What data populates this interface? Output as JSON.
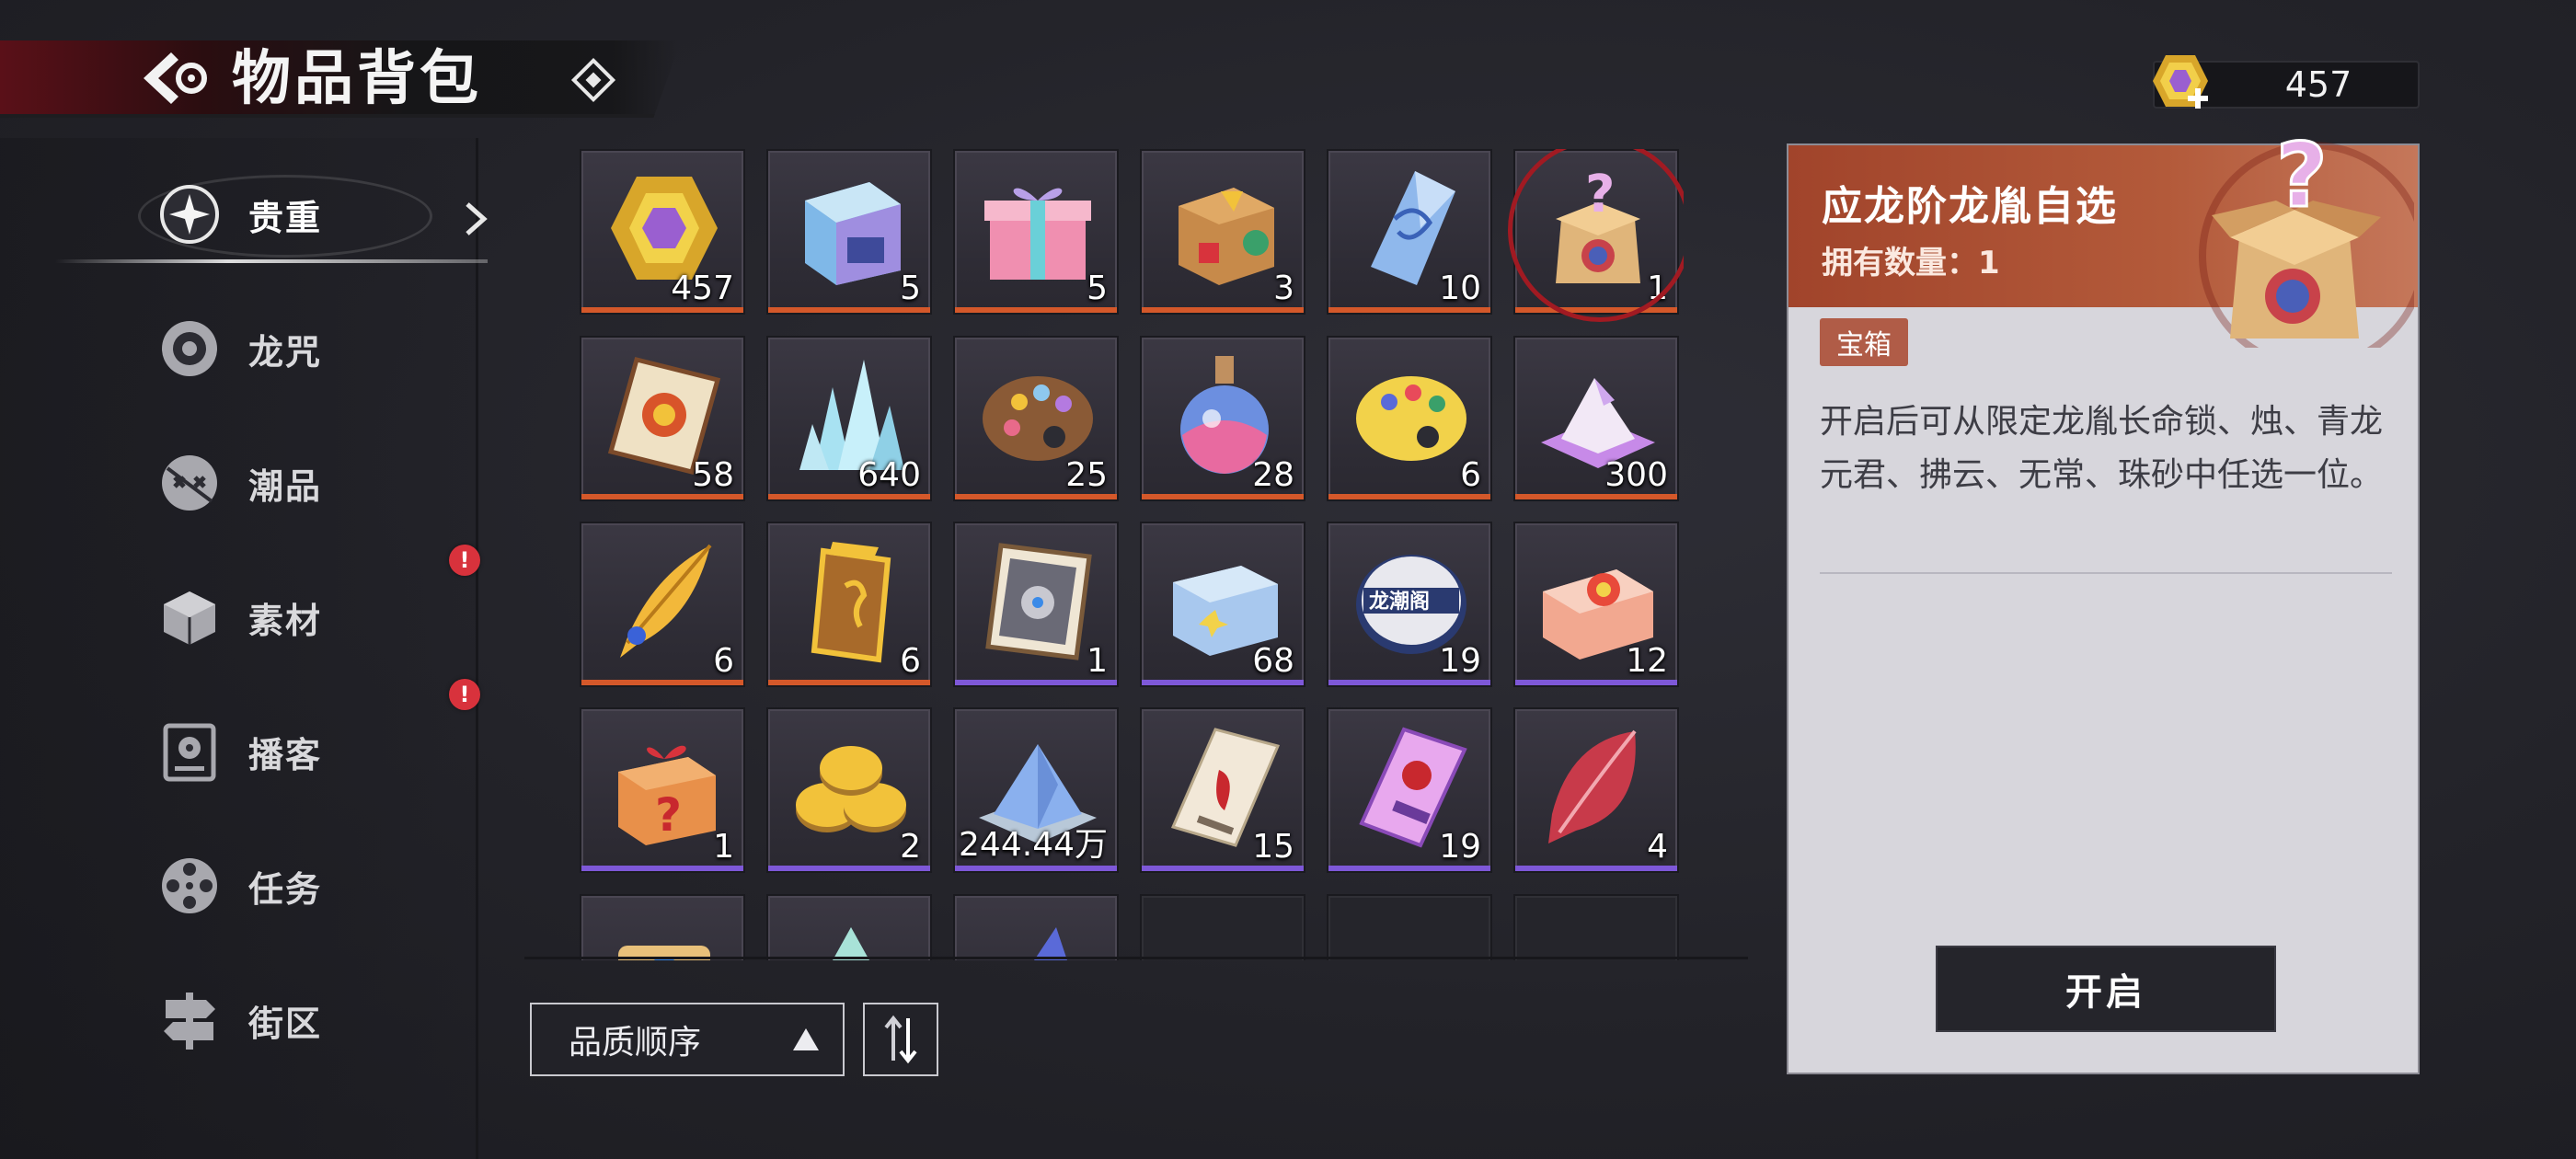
{
  "header": {
    "title": "物品背包",
    "currency_value": "457"
  },
  "sidebar": {
    "items": [
      {
        "label": "贵重",
        "icon": "sparkle-icon",
        "active": true
      },
      {
        "label": "龙咒",
        "icon": "disc-icon"
      },
      {
        "label": "潮品",
        "icon": "mask-icon"
      },
      {
        "label": "素材",
        "icon": "cube-icon",
        "badge": "!"
      },
      {
        "label": "播客",
        "icon": "radio-icon",
        "badge": "!"
      },
      {
        "label": "任务",
        "icon": "film-reel-icon"
      },
      {
        "label": "街区",
        "icon": "signpost-icon"
      }
    ]
  },
  "grid": {
    "items": [
      {
        "name": "gem-currency",
        "count": "457",
        "quality": "orange"
      },
      {
        "name": "holo-cube",
        "count": "5",
        "quality": "orange"
      },
      {
        "name": "gift-box",
        "count": "5",
        "quality": "orange"
      },
      {
        "name": "wooden-toy-box",
        "count": "3",
        "quality": "orange"
      },
      {
        "name": "blue-crystal-shard",
        "count": "10",
        "quality": "orange"
      },
      {
        "name": "mystery-box",
        "count": "1",
        "quality": "orange",
        "selected": true
      },
      {
        "name": "talisman-ticket",
        "count": "58",
        "quality": "orange"
      },
      {
        "name": "ice-crystals",
        "count": "640",
        "quality": "orange"
      },
      {
        "name": "paint-palette-brown",
        "count": "25",
        "quality": "orange"
      },
      {
        "name": "potion-flask",
        "count": "28",
        "quality": "orange"
      },
      {
        "name": "paint-palette-yellow",
        "count": "6",
        "quality": "orange"
      },
      {
        "name": "purple-mountain",
        "count": "300",
        "quality": "orange"
      },
      {
        "name": "golden-feather",
        "count": "6",
        "quality": "orange"
      },
      {
        "name": "golden-plaque",
        "count": "6",
        "quality": "orange"
      },
      {
        "name": "robot-card",
        "count": "1",
        "quality": "purple"
      },
      {
        "name": "blue-gift-box",
        "count": "68",
        "quality": "purple"
      },
      {
        "name": "longchao-badge",
        "count": "19",
        "quality": "purple"
      },
      {
        "name": "candy-box",
        "count": "12",
        "quality": "purple"
      },
      {
        "name": "orange-mystery-box",
        "count": "1",
        "quality": "purple"
      },
      {
        "name": "gold-coins",
        "count": "2",
        "quality": "purple"
      },
      {
        "name": "blue-sand-pile",
        "count": "244.44万",
        "quality": "purple"
      },
      {
        "name": "ticket-stub",
        "count": "15",
        "quality": "purple"
      },
      {
        "name": "pink-ticket",
        "count": "19",
        "quality": "purple"
      },
      {
        "name": "red-leaf-gem",
        "count": "4",
        "quality": "purple"
      }
    ]
  },
  "sort": {
    "label": "品质顺序"
  },
  "detail": {
    "name": "应龙阶龙胤自选",
    "owned": "拥有数量：1",
    "tag": "宝箱",
    "description": "开启后可从限定龙胤长命锁、烛、青龙元君、拂云、无常、珠砂中任选一位。",
    "open_button": "开启"
  },
  "colors": {
    "accent": "#b05c47",
    "quality_orange": "#d4582a",
    "quality_purple": "#7e58d8",
    "badge_red": "#d8323c"
  }
}
